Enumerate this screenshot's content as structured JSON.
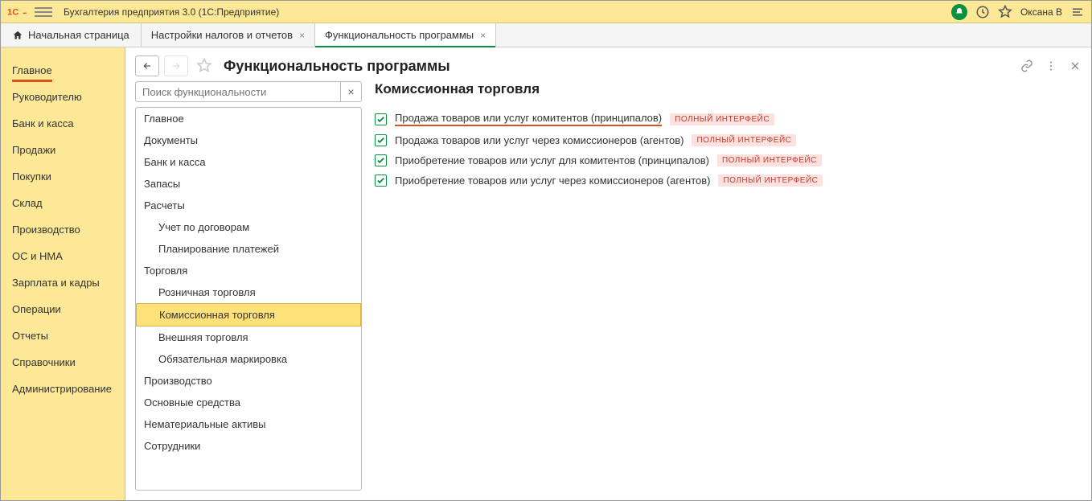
{
  "titlebar": {
    "app_title": "Бухгалтерия предприятия 3.0  (1С:Предприятие)",
    "user": "Оксана В"
  },
  "tabs": {
    "home": "Начальная страница",
    "tab1": "Настройки налогов и отчетов",
    "tab2": "Функциональность программы"
  },
  "sidebar": {
    "items": [
      "Главное",
      "Руководителю",
      "Банк и касса",
      "Продажи",
      "Покупки",
      "Склад",
      "Производство",
      "ОС и НМА",
      "Зарплата и кадры",
      "Операции",
      "Отчеты",
      "Справочники",
      "Администрирование"
    ]
  },
  "page": {
    "title": "Функциональность программы",
    "search_placeholder": "Поиск функциональности"
  },
  "tree": [
    {
      "label": "Главное",
      "indent": false
    },
    {
      "label": "Документы",
      "indent": false
    },
    {
      "label": "Банк и касса",
      "indent": false
    },
    {
      "label": "Запасы",
      "indent": false
    },
    {
      "label": "Расчеты",
      "indent": false
    },
    {
      "label": "Учет по договорам",
      "indent": true
    },
    {
      "label": "Планирование платежей",
      "indent": true
    },
    {
      "label": "Торговля",
      "indent": false
    },
    {
      "label": "Розничная торговля",
      "indent": true
    },
    {
      "label": "Комиссионная торговля",
      "indent": true,
      "selected": true
    },
    {
      "label": "Внешняя торговля",
      "indent": true
    },
    {
      "label": "Обязательная маркировка",
      "indent": true
    },
    {
      "label": "Производство",
      "indent": false
    },
    {
      "label": "Основные средства",
      "indent": false
    },
    {
      "label": "Нематериальные активы",
      "indent": false
    },
    {
      "label": "Сотрудники",
      "indent": false
    }
  ],
  "settings": {
    "title": "Комиссионная торговля",
    "badge": "ПОЛНЫЙ ИНТЕРФЕЙС",
    "items": [
      {
        "label": "Продажа товаров или услуг комитентов (принципалов)",
        "underlined": true
      },
      {
        "label": "Продажа товаров или услуг через комиссионеров (агентов)",
        "underlined": false
      },
      {
        "label": "Приобретение товаров или услуг для комитентов (принципалов)",
        "underlined": false
      },
      {
        "label": "Приобретение товаров или услуг через комиссионеров (агентов)",
        "underlined": false
      }
    ]
  }
}
